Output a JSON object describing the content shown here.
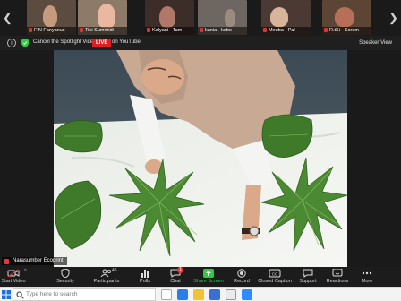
{
  "gallery": {
    "thumbnails": [
      {
        "name": "FIN Fanyanus",
        "bg": "#5b4c3f",
        "fig": "#c59b80"
      },
      {
        "name": "Tini Sumendi",
        "bg": "#8d7a68",
        "fig": "#e8b9a0"
      },
      {
        "name": "Kalyani - Tam",
        "bg": "#3d2d28",
        "fig": "#b07868"
      },
      {
        "name": "kania - kebo",
        "bg": "#6e6660",
        "fig": "#9a8a80"
      },
      {
        "name": "Meuba - Pal",
        "bg": "#4a3a33",
        "fig": "#d8b49a"
      },
      {
        "name": "R.tSi - Sorum",
        "bg": "#5c4535",
        "fig": "#b86f5a"
      }
    ]
  },
  "info_bar": {
    "spotlight_label": "Cancel the Spotlight Video",
    "live_label": "LIVE",
    "live_platform": "on YouTube",
    "view_label": "Speaker View"
  },
  "video": {
    "speaker_name": "Narasumber Ecoprint"
  },
  "toolbar": {
    "buttons": [
      {
        "label": "Start Video"
      },
      {
        "label": "Security"
      },
      {
        "label": "Participants",
        "count": "45"
      },
      {
        "label": "Polls"
      },
      {
        "label": "Chat",
        "badge": "1"
      },
      {
        "label": "Share Screen"
      },
      {
        "label": "Record"
      },
      {
        "label": "Closed Caption"
      },
      {
        "label": "Support"
      },
      {
        "label": "Reactions"
      },
      {
        "label": "More"
      }
    ]
  },
  "taskbar": {
    "search_placeholder": "Type here to search"
  },
  "colors": {
    "live_red": "#e02020",
    "share_green": "#2ecc40",
    "chat_badge_red": "#e33333"
  }
}
